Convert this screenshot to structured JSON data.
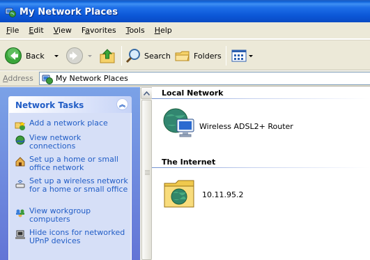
{
  "window": {
    "title": "My Network Places",
    "icon": "network-places-icon"
  },
  "menu": [
    {
      "label": "File",
      "key": "F",
      "rest": "ile"
    },
    {
      "label": "Edit",
      "key": "E",
      "rest": "dit"
    },
    {
      "label": "View",
      "key": "V",
      "rest": "iew"
    },
    {
      "label": "Favorites",
      "key": "",
      "prefix": "F",
      "key2": "a",
      "rest": "vorites"
    },
    {
      "label": "Tools",
      "key": "T",
      "rest": "ools"
    },
    {
      "label": "Help",
      "key": "H",
      "rest": "elp"
    }
  ],
  "toolbar": {
    "back_label": "Back",
    "search_label": "Search",
    "folders_label": "Folders"
  },
  "address": {
    "label": "Address",
    "value": "My Network Places"
  },
  "tasks": {
    "header": "Network Tasks",
    "items": [
      {
        "label": "Add a network place",
        "icon": "add-network-place-icon"
      },
      {
        "label": "View network connections",
        "icon": "network-connections-icon"
      },
      {
        "label": "Set up a home or small office network",
        "icon": "home-network-icon"
      },
      {
        "label": "Set up a wireless network for a home or small office",
        "icon": "wireless-network-icon"
      },
      {
        "label": "View workgroup computers",
        "icon": "workgroup-icon"
      },
      {
        "label": "Hide icons for networked UPnP devices",
        "icon": "upnp-device-icon"
      }
    ]
  },
  "content": {
    "groups": [
      {
        "title": "Local Network",
        "items": [
          {
            "label": "Wireless ADSL2+ Router",
            "icon": "router-globe-icon"
          }
        ]
      },
      {
        "title": "The Internet",
        "items": [
          {
            "label": "10.11.95.2",
            "icon": "internet-folder-icon"
          }
        ]
      }
    ]
  },
  "colors": {
    "titlebar": "#0b56d6",
    "task_link": "#215dc6",
    "task_pane_bg": "#6375d6",
    "task_body_bg": "#d6dff7"
  }
}
